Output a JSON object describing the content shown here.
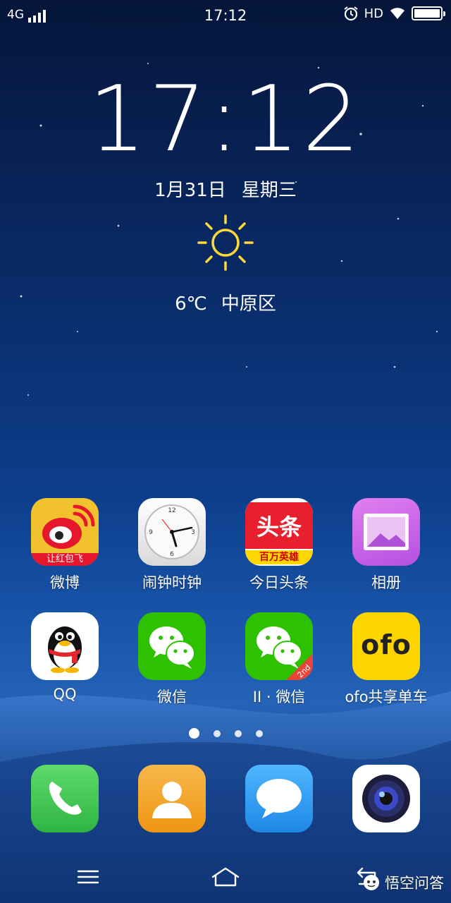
{
  "status_bar": {
    "network": "4G",
    "signal_bars": 4,
    "time": "17:12",
    "hd_label": "HD",
    "battery_level": 1.0
  },
  "clock_widget": {
    "time": "17:12",
    "date": "1月31日",
    "weekday": "星期三",
    "weather_icon": "sun-icon",
    "temperature": "6℃",
    "location": "中原区"
  },
  "apps": [
    {
      "label": "微博",
      "icon": "weibo-icon",
      "badge_text": "让红包飞"
    },
    {
      "label": "闹钟时钟",
      "icon": "clock-icon"
    },
    {
      "label": "今日头条",
      "icon": "toutiao-icon",
      "badge_top": "头条",
      "badge_bottom": "百万英雄"
    },
    {
      "label": "相册",
      "icon": "gallery-icon"
    },
    {
      "label": "QQ",
      "icon": "qq-penguin-icon"
    },
    {
      "label": "微信",
      "icon": "wechat-icon"
    },
    {
      "label": "II · 微信",
      "icon": "wechat-clone-icon",
      "corner": "2nd"
    },
    {
      "label": "ofo共享单车",
      "icon": "ofo-icon",
      "logo_text": "ofo"
    }
  ],
  "pager": {
    "pages": 4,
    "current": 1
  },
  "dock": [
    {
      "icon": "phone-icon"
    },
    {
      "icon": "contacts-icon"
    },
    {
      "icon": "messages-icon"
    },
    {
      "icon": "camera-icon"
    }
  ],
  "nav_bar": {
    "menu": "menu-icon",
    "home": "home-icon",
    "back": "back-icon"
  },
  "watermark": {
    "text": "悟空问答"
  },
  "colors": {
    "weibo_bg": "#f2c12e",
    "weibo_red": "#e6162d",
    "toutiao_red": "#e8202e",
    "gallery_bg": "#c764e6",
    "wechat_green": "#2dc100",
    "ofo_yellow": "#ffd500",
    "phone_green": "#3fc652",
    "contacts_orange": "#f5a623",
    "messages_blue": "#2f9bf0",
    "sun_yellow": "#ffd83b"
  }
}
